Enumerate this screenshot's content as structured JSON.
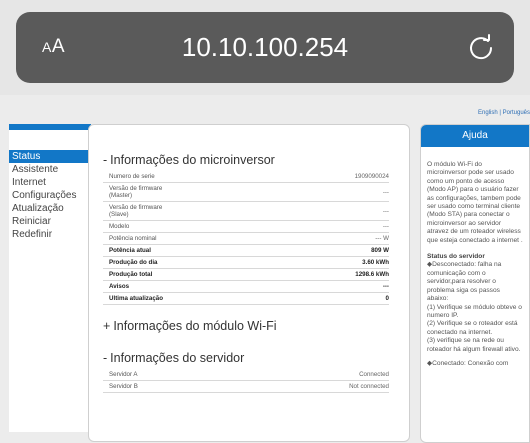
{
  "browser": {
    "text_size_label_small": "A",
    "text_size_label_large": "A",
    "url": "10.10.100.254"
  },
  "language": {
    "english": "English",
    "separator": " | ",
    "portuguese": "Português"
  },
  "menu": [
    {
      "label": "Status",
      "active": true
    },
    {
      "label": "Assistente",
      "active": false
    },
    {
      "label": "Internet",
      "active": false
    },
    {
      "label": "Configurações",
      "active": false
    },
    {
      "label": "Atualização",
      "active": false
    },
    {
      "label": "Reiniciar",
      "active": false
    },
    {
      "label": "Redefinir",
      "active": false
    }
  ],
  "microinverter": {
    "sign": "-",
    "title": "Informações do microinversor",
    "rows": [
      {
        "label": "Numero de serie",
        "value": "1909090024",
        "bold": false
      },
      {
        "label": "Versão de firmware\n(Master)",
        "value": "---",
        "bold": false
      },
      {
        "label": "Versão de firmware\n(Slave)",
        "value": "---",
        "bold": false
      },
      {
        "label": "Modelo",
        "value": "---",
        "bold": false
      },
      {
        "label": "Potência nominal",
        "value": "--- W",
        "bold": false
      },
      {
        "label": "Potência atual",
        "value": "809 W",
        "bold": true
      },
      {
        "label": "Produção do dia",
        "value": "3.60 kWh",
        "bold": true
      },
      {
        "label": "Produção total",
        "value": "1298.6 kWh",
        "bold": true
      },
      {
        "label": "Avisos",
        "value": "---",
        "bold": true
      },
      {
        "label": "Ultima atualização",
        "value": "0",
        "bold": true
      }
    ]
  },
  "wifi_module": {
    "sign": "+",
    "title": "Informações do módulo Wi-Fi"
  },
  "server": {
    "sign": "-",
    "title": "Informações do servidor",
    "rows": [
      {
        "label": "Servidor A",
        "value": "Connected"
      },
      {
        "label": "Servidor B",
        "value": "Not connected"
      }
    ]
  },
  "help": {
    "title": "Ajuda",
    "intro": "O módulo Wi-Fi do microinversor pode ser usado como um ponto de acesso (Modo AP) para o usuário fazer as configurações, tambem pode ser usado como terminal cliente (Modo STA) para conectar o microinversor ao servidor atravez de um roteador wireless que esteja conectado a internet .",
    "server_status_title": "Status do servidor",
    "disconnected": "◆Desconectado: falha na comunicação com o servidor,para resolver o problema siga os passos abaixo:",
    "step1": "(1) Verifique se módulo obteve o numero IP.",
    "step2": "(2) Verifique se o roteador está conectado na internet.",
    "step3": "(3) verifique se na rede ou roteador há algum firewall ativo.",
    "connected": "◆Conectado: Conexão com"
  }
}
